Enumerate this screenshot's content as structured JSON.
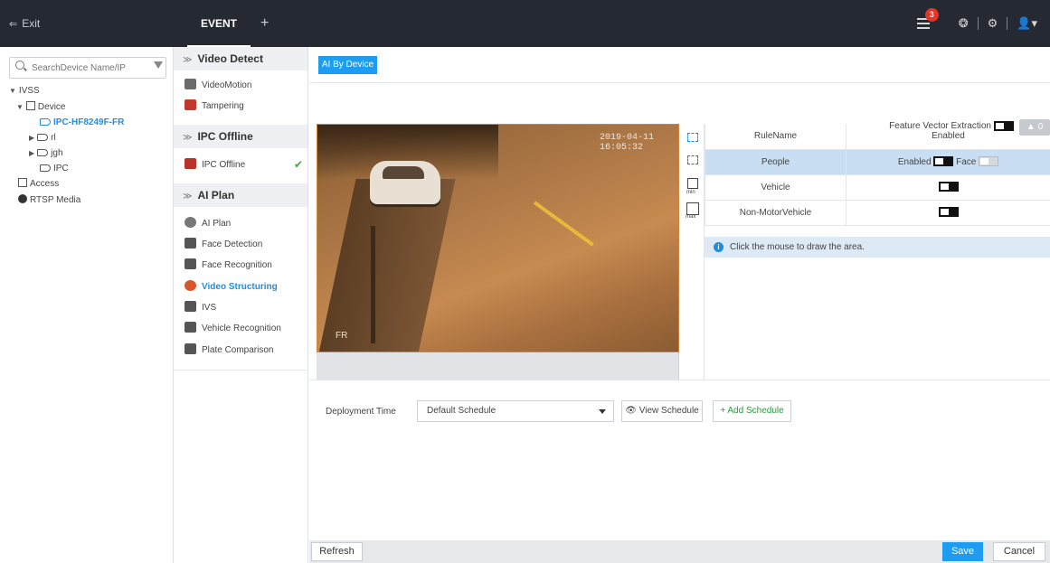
{
  "topbar": {
    "exit_label": "Exit",
    "tab_label": "EVENT",
    "tab_add": "+",
    "notification_count": "3"
  },
  "search": {
    "placeholder": "SearchDevice Name/IP"
  },
  "tree": {
    "root": "IVSS",
    "device": "Device",
    "selected_camera": "IPC-HF8249F-FR",
    "cam_rl": "rl",
    "cam_jgh": "jgh",
    "cam_ipc": "IPC",
    "access": "Access",
    "rtsp": "RTSP Media"
  },
  "events": {
    "video_detect": {
      "title": "Video Detect",
      "items": [
        "VideoMotion",
        "Tampering"
      ]
    },
    "ipc_offline": {
      "title": "IPC Offline",
      "items": [
        "IPC Offline"
      ]
    },
    "ai_plan": {
      "title": "AI Plan",
      "items": [
        "AI Plan",
        "Face Detection",
        "Face Recognition",
        "Video Structuring",
        "IVS",
        "Vehicle Recognition",
        "Plate Comparison"
      ]
    }
  },
  "main": {
    "ai_by_device": "AI By Device",
    "feature_vector": "Feature Vector Extraction",
    "warning_count": "0",
    "video_timestamp": "2019-04-11 16:05:32",
    "video_overlay": "FR",
    "rules": {
      "header": [
        "RuleName",
        "Enabled"
      ],
      "rows": [
        {
          "name": "People",
          "enabled_label": "Enabled",
          "face_label": "Face"
        },
        {
          "name": "Vehicle"
        },
        {
          "name": "Non-MotorVehicle"
        }
      ]
    },
    "info_text": "Click the mouse to draw the area.",
    "deployment_label": "Deployment Time",
    "schedule_value": "Default Schedule",
    "view_schedule": "View Schedule",
    "add_schedule": "Add Schedule",
    "tool_labels": {
      "min": "min",
      "max": "max"
    }
  },
  "footer": {
    "refresh": "Refresh",
    "save": "Save",
    "cancel": "Cancel"
  },
  "colors": {
    "accent": "#1e9cf0",
    "topbar": "#252932",
    "add_green": "#2b9a3c",
    "badge": "#e63228"
  }
}
